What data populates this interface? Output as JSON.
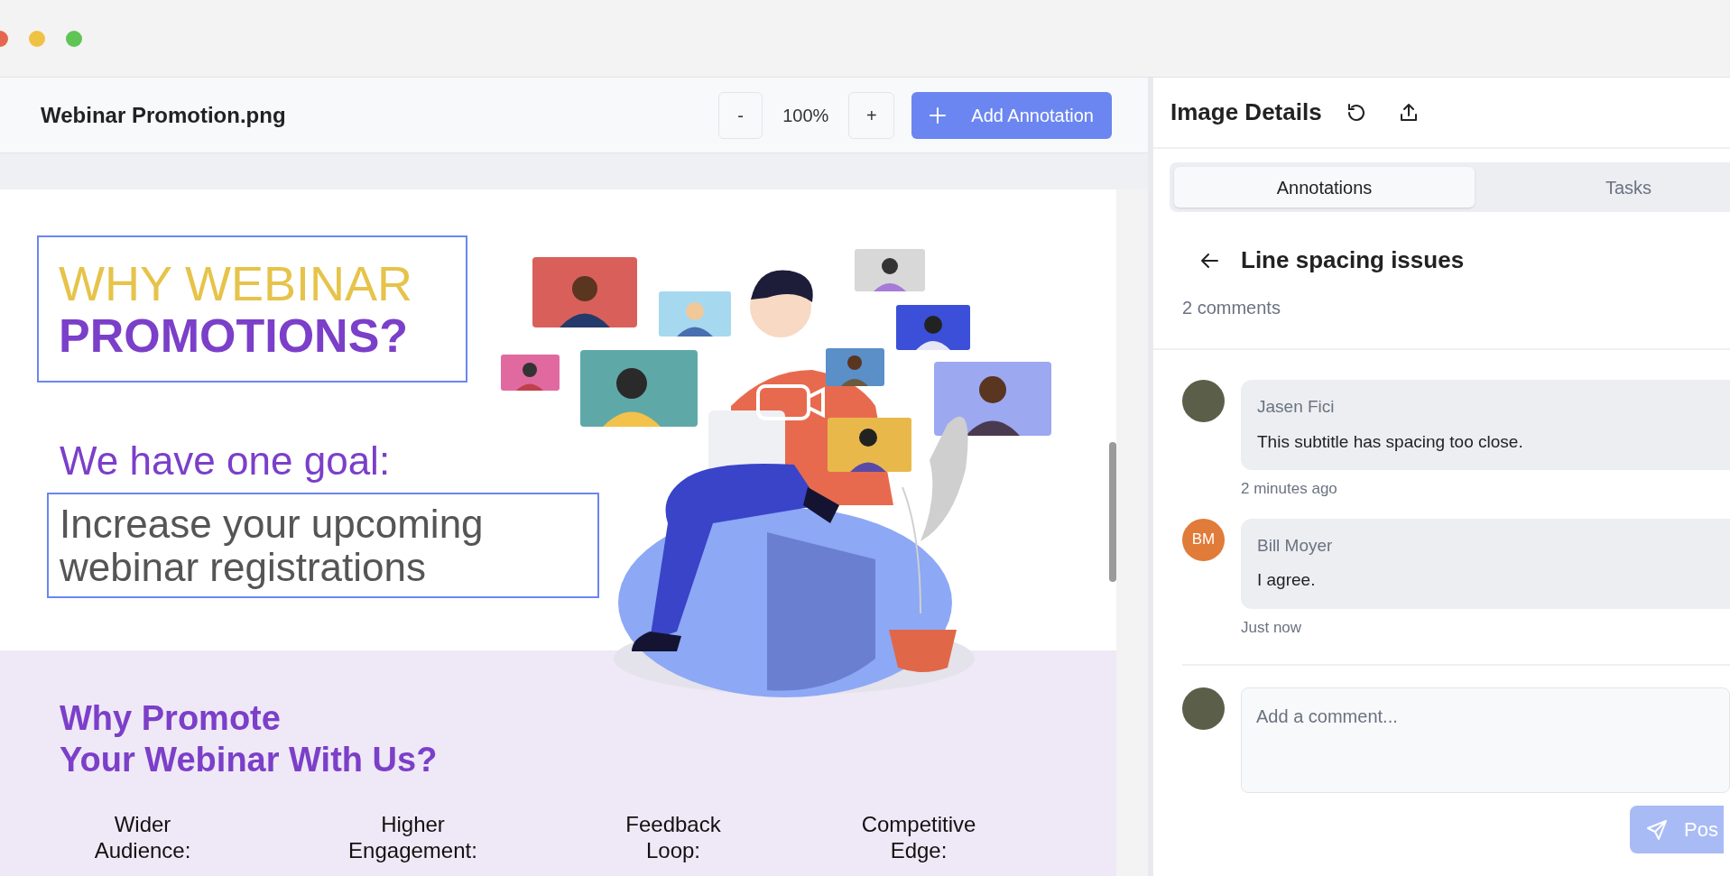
{
  "window": {
    "file_name": "Webinar Promotion.png"
  },
  "toolbar": {
    "zoom_out": "-",
    "zoom_level": "100%",
    "zoom_in": "+",
    "add_button": "Add Annotation"
  },
  "poster": {
    "title_line_1": "WHY WEBINAR",
    "title_line_2": "PROMOTIONS?",
    "goal_heading": "We have one goal:",
    "goal_text": "Increase your upcoming webinar registrations",
    "section_heading": [
      "Why Promote",
      "Your Webinar With Us?"
    ],
    "benefits": [
      {
        "lines": [
          "Wider",
          "Audience:"
        ]
      },
      {
        "lines": [
          "Higher",
          "Engagement:"
        ]
      },
      {
        "lines": [
          "Feedback",
          "Loop:"
        ]
      },
      {
        "lines": [
          "Competitive",
          "Edge:"
        ]
      }
    ]
  },
  "panel": {
    "title": "Image Details",
    "tabs": [
      {
        "label": "Annotations",
        "selected": true
      },
      {
        "label": "Tasks",
        "selected": false
      }
    ],
    "annotation": {
      "title": "Line spacing issues",
      "count": "2 comments"
    },
    "comments": [
      {
        "author": "Jasen Fici",
        "text": "This subtitle has spacing too close.",
        "time": "2 minutes ago",
        "avatar": {
          "kind": "photo"
        }
      },
      {
        "author": "Bill Moyer",
        "text": "I agree.",
        "time": "Just now",
        "avatar": {
          "kind": "initials",
          "initials": "BM",
          "color": "#e07b39"
        }
      }
    ],
    "composer": {
      "placeholder": "Add a comment...",
      "button": "Pos"
    }
  }
}
